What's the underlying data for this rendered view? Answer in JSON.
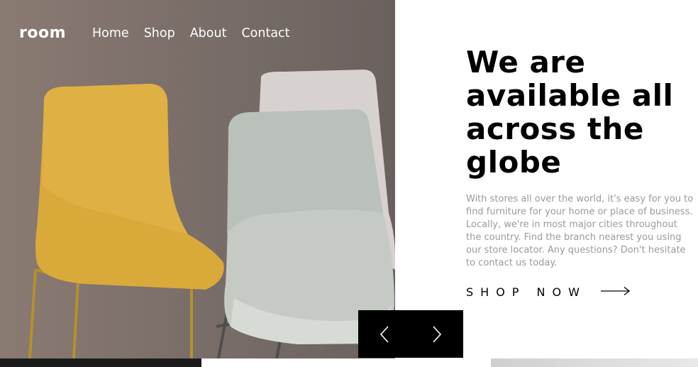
{
  "brand": {
    "logo": "room"
  },
  "nav": {
    "items": [
      "Home",
      "Shop",
      "About",
      "Contact"
    ]
  },
  "hero": {
    "image_icon": "chairs-photo",
    "headline": "We are available all across the globe",
    "description": "With stores all over the world, it's easy for you to find furniture for your home or place of business. Locally, we're in most major cities throughout the country. Find the branch nearest you using our store locator. Any questions? Don't hesitate to contact us today.",
    "cta_label": "SHOP NOW"
  },
  "slider": {
    "prev_icon": "chevron-left-icon",
    "next_icon": "chevron-right-icon"
  },
  "colors": {
    "accent": "#000000",
    "text_muted": "#9a9a9a",
    "chair_yellow": "#d9a93a",
    "chair_grey": "#c5cbc4"
  }
}
